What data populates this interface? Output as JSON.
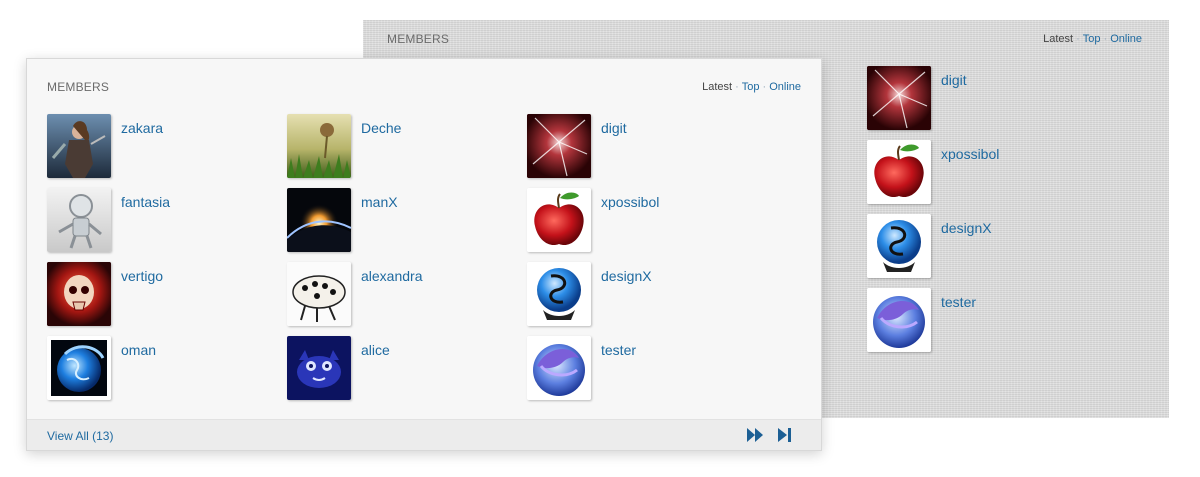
{
  "back_widget": {
    "title": "MEMBERS",
    "filters": {
      "latest": "Latest",
      "top": "Top",
      "online": "Online"
    },
    "members": [
      {
        "name": "digit",
        "avatar": "abstract-red-burst"
      },
      {
        "name": "xpossibol",
        "avatar": "red-apple"
      },
      {
        "name": "designX",
        "avatar": "blue-dragon-orb"
      },
      {
        "name": "tester",
        "avatar": "dolphin-orb"
      }
    ]
  },
  "front_widget": {
    "title": "MEMBERS",
    "filters": {
      "latest": "Latest",
      "top": "Top",
      "online": "Online"
    },
    "members": [
      {
        "name": "zakara",
        "avatar": "warrior-woman"
      },
      {
        "name": "Deche",
        "avatar": "grass-sprout"
      },
      {
        "name": "digit",
        "avatar": "abstract-red-burst"
      },
      {
        "name": "fantasia",
        "avatar": "silver-robot"
      },
      {
        "name": "manX",
        "avatar": "planet-eclipse"
      },
      {
        "name": "xpossibol",
        "avatar": "red-apple"
      },
      {
        "name": "vertigo",
        "avatar": "red-skull"
      },
      {
        "name": "alexandra",
        "avatar": "spotted-bug"
      },
      {
        "name": "designX",
        "avatar": "blue-dragon-orb"
      },
      {
        "name": "oman",
        "avatar": "blue-globe"
      },
      {
        "name": "alice",
        "avatar": "blue-creature"
      },
      {
        "name": "tester",
        "avatar": "dolphin-orb"
      }
    ],
    "footer": {
      "view_all": "View All (13)"
    }
  },
  "icons": {
    "next": "fast-forward-icon",
    "last": "skip-to-end-icon"
  },
  "colors": {
    "link": "#1f6aa0",
    "pager": "#1c5f94",
    "back_panel": "#dadada",
    "front_panel": "#f7f7f7",
    "footer": "#ececec"
  }
}
